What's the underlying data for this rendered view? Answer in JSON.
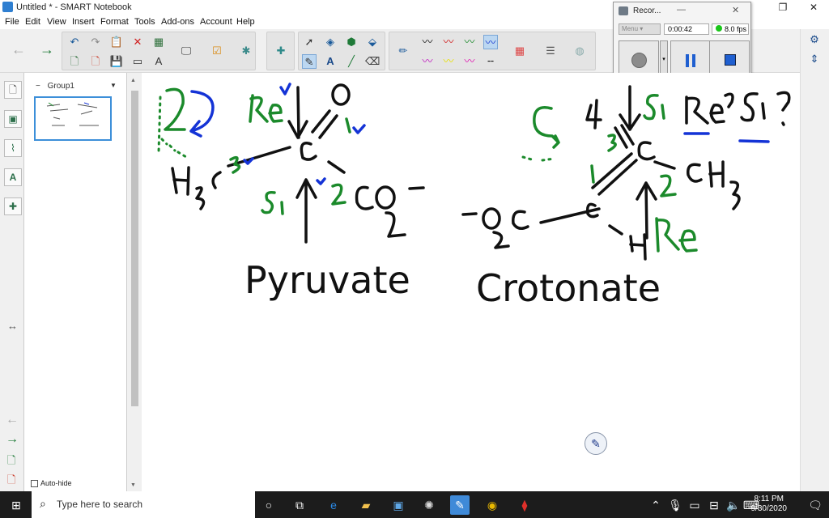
{
  "window": {
    "title": "Untitled * - SMART Notebook",
    "minimize_glyph": "—",
    "restore_glyph": "❐",
    "close_glyph": "✕"
  },
  "menu": [
    "File",
    "Edit",
    "View",
    "Insert",
    "Format",
    "Tools",
    "Add-ons",
    "Account",
    "Help"
  ],
  "sorter": {
    "group_label": "Group1",
    "collapse_glyph": "−",
    "dropdown_glyph": "▼",
    "autohide_label": "Auto-hide"
  },
  "recorder": {
    "title": "Recor...",
    "menu_label": "Menu",
    "elapsed": "0:00:42",
    "fps": "8.0 fps",
    "status_color": "#19c619"
  },
  "drawing": {
    "pyruvate_label": "Pyruvate",
    "crotonate_label": "Crotonate",
    "question_re": "Re?",
    "question_si": "Si?",
    "ink_black": "#111111",
    "ink_green": "#1b8a2b",
    "ink_blue": "#1433d6"
  },
  "taskbar": {
    "search_placeholder": "Type here to search",
    "time": "8:11 PM",
    "date": "9/30/2020"
  }
}
